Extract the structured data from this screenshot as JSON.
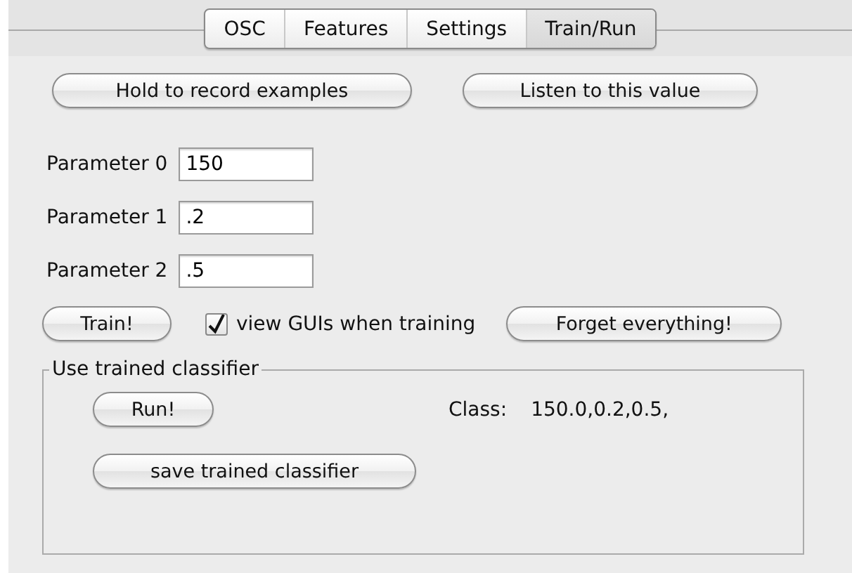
{
  "tabs": [
    {
      "label": "OSC",
      "selected": false
    },
    {
      "label": "Features",
      "selected": false
    },
    {
      "label": "Settings",
      "selected": false
    },
    {
      "label": "Train/Run",
      "selected": true
    }
  ],
  "top_buttons": [
    "Hold to record examples",
    "Listen to this value"
  ],
  "parameters": [
    {
      "label": "Parameter 0",
      "value": "150"
    },
    {
      "label": "Parameter 1",
      "value": ".2"
    },
    {
      "label": "Parameter 2",
      "value": ".5"
    }
  ],
  "train_button": "Train!",
  "view_guis": {
    "label": "view GUIs when training",
    "checked": true
  },
  "forget_button": "Forget everything!",
  "classifier_group": {
    "title": "Use trained classifier",
    "run_button": "Run!",
    "class_label": "Class:",
    "class_value": "150.0,0.2,0.5,",
    "save_button": "save trained classifier"
  }
}
